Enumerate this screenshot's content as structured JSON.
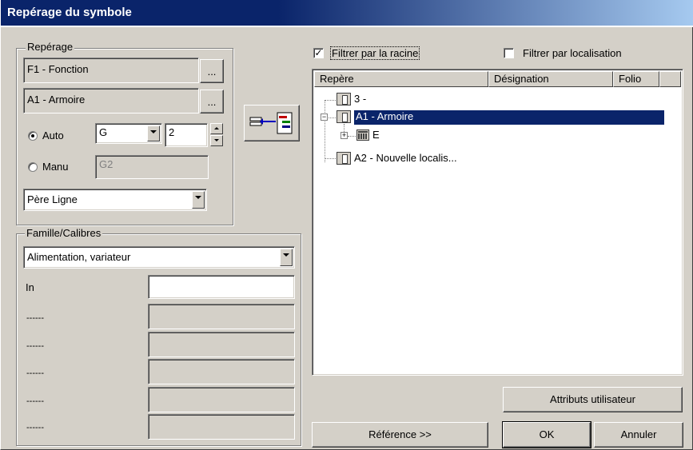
{
  "window": {
    "title": "Repérage du symbole"
  },
  "reperage": {
    "group_label": "Repérage",
    "fonction_value": "F1 - Fonction",
    "armoire_value": "A1 - Armoire",
    "browse_label": "...",
    "auto_label": "Auto",
    "auto_selected": true,
    "auto_letter": "G",
    "auto_number": "2",
    "manu_label": "Manu",
    "manu_value": "G2",
    "pere_value": "Père Ligne"
  },
  "famille": {
    "group_label": "Famille/Calibres",
    "selected": "Alimentation, variateur",
    "rows": [
      {
        "label": "In",
        "value": ""
      },
      {
        "label": "------",
        "value": ""
      },
      {
        "label": "------",
        "value": ""
      },
      {
        "label": "------",
        "value": ""
      },
      {
        "label": "------",
        "value": ""
      },
      {
        "label": "------",
        "value": ""
      }
    ]
  },
  "filters": {
    "racine_label": "Filtrer par la racine",
    "racine_checked": true,
    "localisation_label": "Filtrer par localisation",
    "localisation_checked": false
  },
  "tree": {
    "columns": [
      "Repère",
      "Désignation",
      "Folio"
    ],
    "rows": [
      {
        "label": "3 -",
        "selected": false
      },
      {
        "label": "A1 - Armoire",
        "selected": true
      },
      {
        "label": "E",
        "selected": false
      },
      {
        "label": "A2 - Nouvelle localis...",
        "selected": false
      }
    ]
  },
  "buttons": {
    "attributs": "Attributs utilisateur",
    "reference": "Référence >>",
    "ok": "OK",
    "annuler": "Annuler"
  },
  "icons": {
    "transfer": "transfer-to-tree-icon",
    "tree_node": "cabinet-node-icon",
    "tree_leaf": "module-leaf-icon"
  },
  "colors": {
    "titlebar": "#0a246a",
    "selection": "#0a246a",
    "face": "#d4d0c8"
  }
}
